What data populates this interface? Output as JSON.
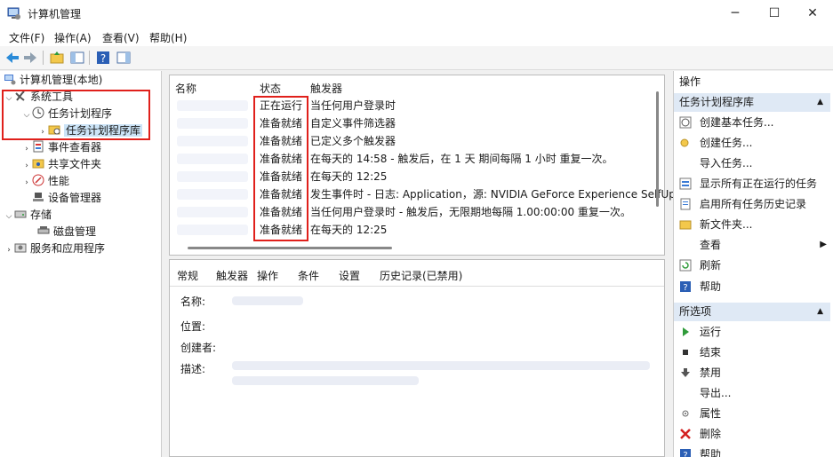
{
  "window": {
    "title": "计算机管理"
  },
  "window_controls": {
    "minimize": "─",
    "maximize": "☐",
    "close": "✕"
  },
  "menu": [
    "文件(F)",
    "操作(A)",
    "查看(V)",
    "帮助(H)"
  ],
  "tree": {
    "root": "计算机管理(本地)",
    "items": [
      {
        "label": "系统工具",
        "icon": "tools-icon"
      },
      {
        "label": "任务计划程序",
        "icon": "clock-icon"
      },
      {
        "label": "任务计划程序库",
        "icon": "folder-clock-icon"
      },
      {
        "label": "事件查看器",
        "icon": "event-viewer-icon"
      },
      {
        "label": "共享文件夹",
        "icon": "shared-folder-icon"
      },
      {
        "label": "性能",
        "icon": "performance-icon"
      },
      {
        "label": "设备管理器",
        "icon": "device-manager-icon"
      },
      {
        "label": "存储",
        "icon": "storage-icon"
      },
      {
        "label": "磁盘管理",
        "icon": "disk-icon"
      },
      {
        "label": "服务和应用程序",
        "icon": "services-icon"
      }
    ]
  },
  "task_list": {
    "columns": [
      "名称",
      "状态",
      "触发器"
    ],
    "rows": [
      {
        "status": "正在运行",
        "trigger": "当任何用户登录时"
      },
      {
        "status": "准备就绪",
        "trigger": "自定义事件筛选器"
      },
      {
        "status": "准备就绪",
        "trigger": "已定义多个触发器"
      },
      {
        "status": "准备就绪",
        "trigger": "在每天的 14:58 - 触发后，在 1 天 期间每隔 1 小时 重复一次。"
      },
      {
        "status": "准备就绪",
        "trigger": "在每天的 12:25"
      },
      {
        "status": "准备就绪",
        "trigger": "发生事件时 - 日志: Application，源: NVIDIA GeForce Experience SelfUp"
      },
      {
        "status": "准备就绪",
        "trigger": "当任何用户登录时 - 触发后，无限期地每隔 1.00:00:00 重复一次。"
      },
      {
        "status": "准备就绪",
        "trigger": "在每天的 12:25"
      }
    ]
  },
  "detail": {
    "tabs": [
      "常规",
      "触发器",
      "操作",
      "条件",
      "设置",
      "历史记录(已禁用)"
    ],
    "fields": [
      "名称:",
      "位置:",
      "创建者:",
      "描述:"
    ]
  },
  "actions": {
    "header": "操作",
    "section1": "任务计划程序库",
    "section1_items": [
      {
        "label": "创建基本任务...",
        "icon": "create-basic-task-icon"
      },
      {
        "label": "创建任务...",
        "icon": "create-task-icon"
      },
      {
        "label": "导入任务...",
        "icon": ""
      },
      {
        "label": "显示所有正在运行的任务",
        "icon": "running-tasks-icon"
      },
      {
        "label": "启用所有任务历史记录",
        "icon": "history-icon"
      },
      {
        "label": "新文件夹...",
        "icon": "new-folder-icon"
      },
      {
        "label": "查看",
        "icon": "",
        "submenu": "▶"
      },
      {
        "label": "刷新",
        "icon": "refresh-icon"
      },
      {
        "label": "帮助",
        "icon": "help-icon"
      }
    ],
    "section2": "所选项",
    "section2_items": [
      {
        "label": "运行",
        "icon": "run-icon"
      },
      {
        "label": "结束",
        "icon": "stop-icon"
      },
      {
        "label": "禁用",
        "icon": "disable-icon"
      },
      {
        "label": "导出...",
        "icon": ""
      },
      {
        "label": "属性",
        "icon": "properties-icon"
      },
      {
        "label": "删除",
        "icon": "delete-icon"
      },
      {
        "label": "帮助",
        "icon": "help-icon"
      }
    ]
  },
  "colors": {
    "highlight": "#e0201b",
    "selection": "#cce4f7",
    "section_bg": "#dfe9f5"
  }
}
